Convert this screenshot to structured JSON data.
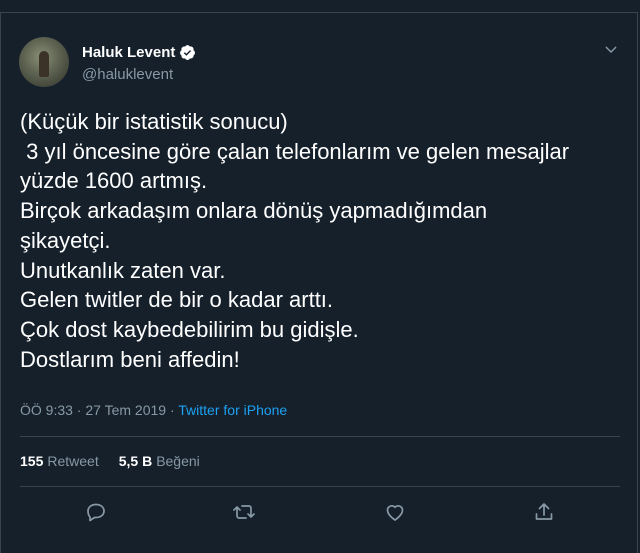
{
  "user": {
    "name": "Haluk Levent",
    "handle": "@haluklevent"
  },
  "tweet": {
    "text": "(Küçük bir istatistik sonucu)\n 3 yıl öncesine göre çalan telefonlarım ve gelen mesajlar\nyüzde 1600 artmış.\nBirçok arkadaşım onlara dönüş yapmadığımdan\nşikayetçi.\nUnutkanlık zaten var.\nGelen twitler de bir o kadar arttı.\nÇok dost kaybedebilirim bu gidişle.\nDostlarım beni affedin!",
    "time": "ÖÖ 9:33",
    "separator": " · ",
    "date": "27 Tem 2019",
    "source": "Twitter for iPhone"
  },
  "stats": {
    "retweet_count": "155",
    "retweet_label": "Retweet",
    "like_count": "5,5 B",
    "like_label": "Beğeni"
  },
  "icons": {
    "verified": "verified-badge-icon",
    "menu": "chevron-down-icon",
    "reply": "reply-icon",
    "retweet": "retweet-icon",
    "like": "heart-icon",
    "share": "share-icon"
  },
  "colors": {
    "background": "#15202b",
    "border": "#38444d",
    "muted": "#8899a6",
    "accent": "#1da1f2"
  }
}
